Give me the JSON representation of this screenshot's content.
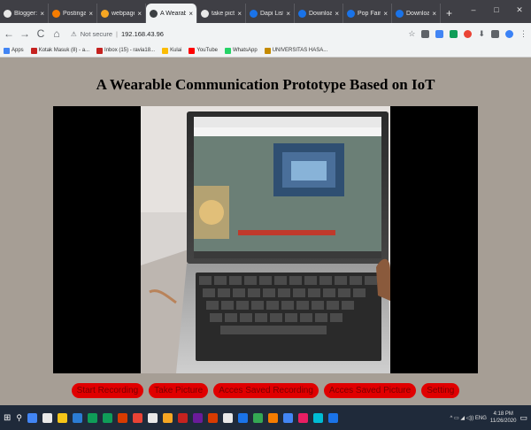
{
  "browser": {
    "tabs": [
      {
        "label": "Blogger: Inl",
        "color": "#e8e8e8"
      },
      {
        "label": "Postingan",
        "color": "#f57c00"
      },
      {
        "label": "webpage -",
        "color": "#f5a623"
      },
      {
        "label": "A Wearable",
        "color": "#3c4043",
        "active": true
      },
      {
        "label": "take pictur",
        "color": "#e8e8e8"
      },
      {
        "label": "Dapi Listri",
        "color": "#1a73e8"
      },
      {
        "label": "Download",
        "color": "#1a73e8"
      },
      {
        "label": "Pop Fair -",
        "color": "#1a73e8"
      },
      {
        "label": "Download",
        "color": "#1a73e8"
      }
    ],
    "tab_close": "×",
    "new_tab": "+",
    "window_controls": {
      "minimize": "–",
      "maximize": "□",
      "close": "✕"
    },
    "nav": {
      "back": "←",
      "forward": "→",
      "reload": "C",
      "home": "⌂"
    },
    "security_label": "Not secure",
    "url": "192.168.43.96",
    "bookmarks": [
      {
        "label": "Apps",
        "color": "#4285f4"
      },
      {
        "label": "Kotak Masuk (8) - a...",
        "color": "#c5221f"
      },
      {
        "label": "Inbox (15) - ravia18...",
        "color": "#c5221f"
      },
      {
        "label": "Kulai",
        "color": "#fbbc04"
      },
      {
        "label": "YouTube",
        "color": "#ff0000"
      },
      {
        "label": "WhatsApp",
        "color": "#25d366"
      },
      {
        "label": "UNIVERSITAS HASA...",
        "color": "#c48a00"
      }
    ]
  },
  "page": {
    "title": "A Wearable Communication Prototype Based on IoT",
    "buttons": [
      {
        "label": "Start Recording",
        "name": "start-recording-button"
      },
      {
        "label": "Take Picture",
        "name": "take-picture-button"
      },
      {
        "label": "Acces Saved Recording",
        "name": "access-saved-recording-button"
      },
      {
        "label": "Acces Saved Picture",
        "name": "access-saved-picture-button"
      },
      {
        "label": "Setting",
        "name": "setting-button"
      }
    ]
  },
  "taskbar": {
    "icons": [
      "#4285f4",
      "#e8e8e8",
      "#f5c518",
      "#2b7cd3",
      "#0f9d58",
      "#0f9d58",
      "#d83b01",
      "#ea4335",
      "#e8e8e8",
      "#f5a623",
      "#c5221f",
      "#6a1b9a",
      "#d83b01",
      "#e8e8e8",
      "#1a73e8",
      "#34a853",
      "#f57c00",
      "#4285f4",
      "#e91e63",
      "#00bcd4",
      "#1a73e8"
    ],
    "tray_text": "^ ▭ ◢ ◁)) ENG",
    "time": "4:18 PM",
    "date": "11/26/2020"
  },
  "colors": {
    "page_bg": "#a69e95",
    "button_bg": "#e00000",
    "button_text": "#7a0000",
    "stream_bg": "#000000"
  }
}
